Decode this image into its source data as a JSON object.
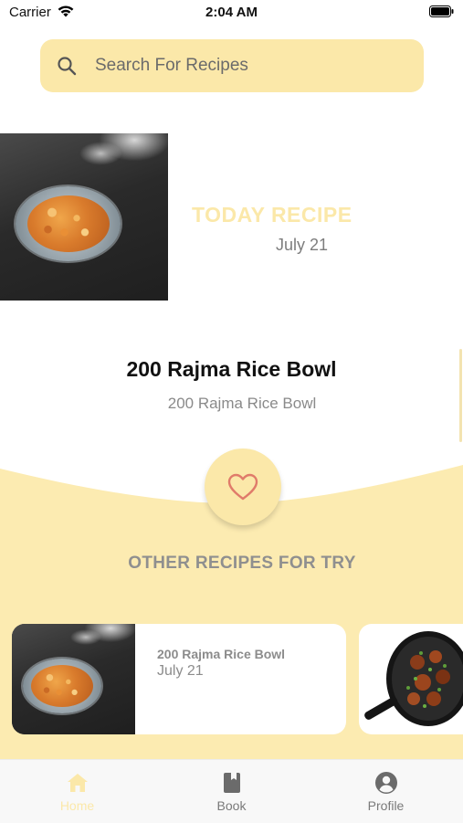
{
  "status_bar": {
    "carrier": "Carrier",
    "time": "2:04 AM"
  },
  "search": {
    "placeholder": "Search For Recipes",
    "icon": "search-icon"
  },
  "today": {
    "label": "TODAY RECIPE",
    "date": "July  21"
  },
  "featured": {
    "title": "200 Rajma Rice Bowl",
    "subtitle": "200 Rajma Rice Bowl",
    "favorite_icon": "heart-icon"
  },
  "other": {
    "label": "OTHER RECIPES FOR TRY",
    "cards": [
      {
        "title": "200 Rajma Rice Bowl",
        "date": "July  21"
      }
    ]
  },
  "tabs": [
    {
      "label": "Home",
      "icon": "home-icon",
      "active": true
    },
    {
      "label": "Book",
      "icon": "book-icon",
      "active": false
    },
    {
      "label": "Profile",
      "icon": "profile-icon",
      "active": false
    }
  ],
  "colors": {
    "accent": "#fbe8a9",
    "heart": "#e07b6a",
    "muted_text": "#8a8a8a"
  }
}
